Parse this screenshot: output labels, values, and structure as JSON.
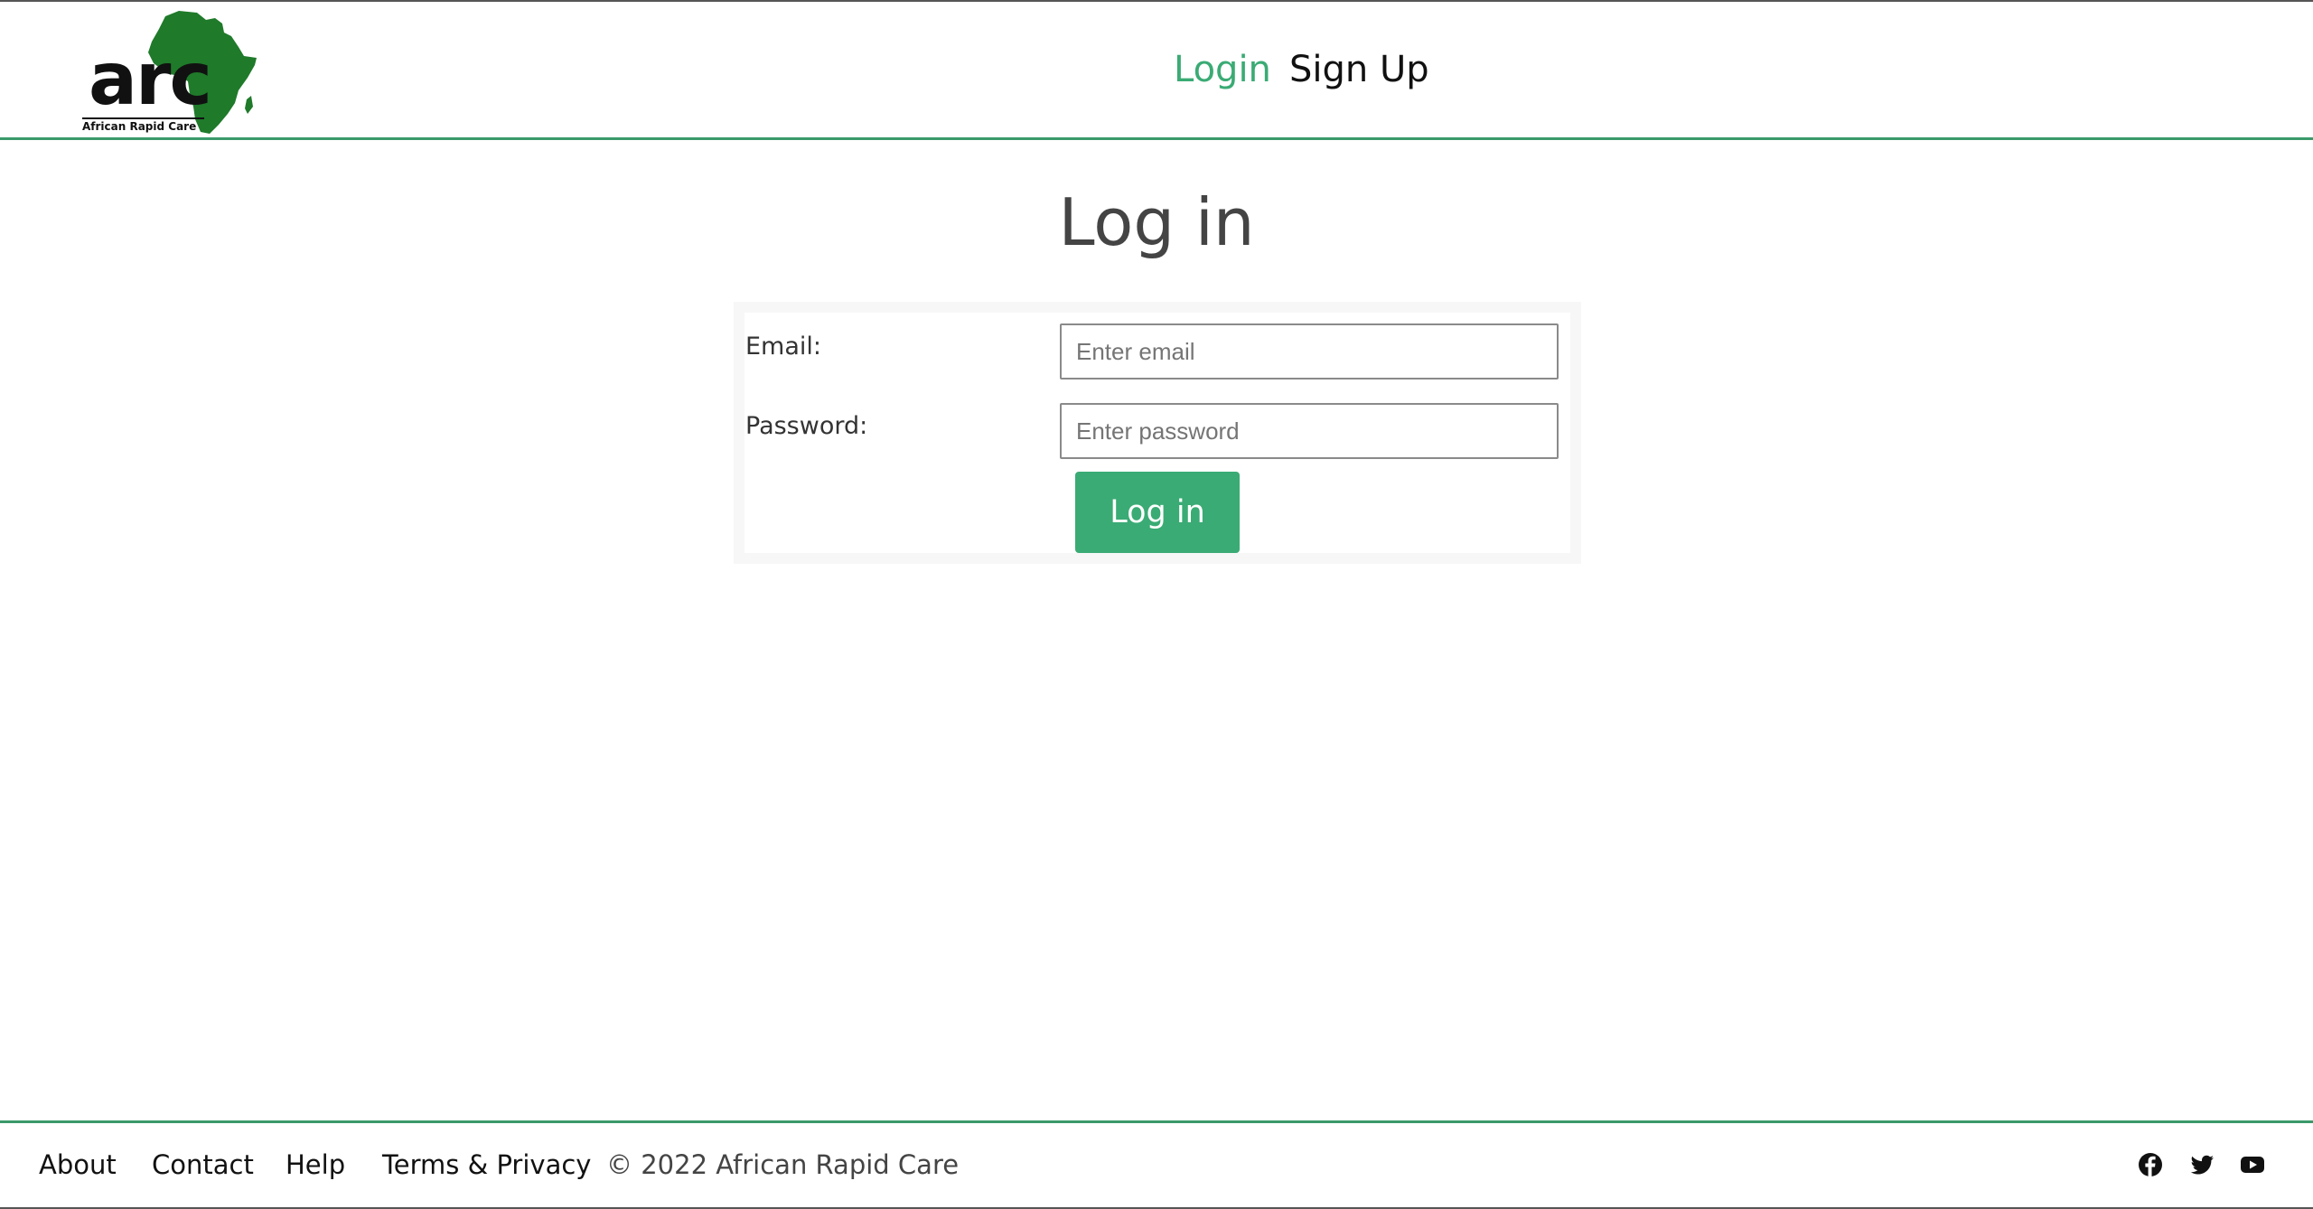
{
  "header": {
    "logo": {
      "text": "arc",
      "subtitle": "African Rapid Care",
      "color": "#1f7a2a"
    },
    "nav": [
      {
        "label": "Login",
        "active": true
      },
      {
        "label": "Sign Up",
        "active": false
      }
    ]
  },
  "page": {
    "title": "Log in"
  },
  "form": {
    "email_label": "Email:",
    "email_placeholder": "Enter email",
    "email_value": "",
    "password_label": "Password:",
    "password_placeholder": "Enter password",
    "password_value": "",
    "submit_label": "Log in"
  },
  "footer": {
    "links": [
      "About",
      "Contact",
      "Help",
      "Terms & Privacy"
    ],
    "copyright": "© 2022 African Rapid Care",
    "social": [
      {
        "icon": "facebook-icon"
      },
      {
        "icon": "twitter-icon"
      },
      {
        "icon": "youtube-icon"
      }
    ]
  },
  "colors": {
    "accent": "#3aab74",
    "divider": "#3a9a6a",
    "logo_green": "#1f7a2a"
  }
}
